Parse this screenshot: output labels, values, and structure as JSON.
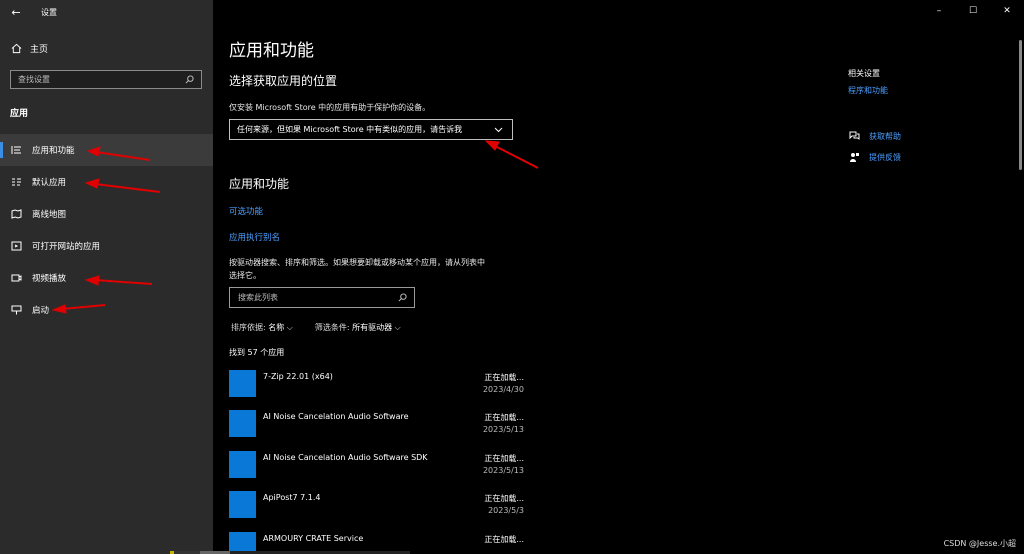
{
  "window": {
    "title": "设置",
    "controls": {
      "minimize": "–",
      "maximize": "☐",
      "close": "✕"
    }
  },
  "sidebar": {
    "home_label": "主页",
    "search_placeholder": "查找设置",
    "section_label": "应用",
    "items": [
      {
        "label": "应用和功能",
        "icon": "apps-list-icon",
        "active": true
      },
      {
        "label": "默认应用",
        "icon": "default-apps-icon",
        "active": false
      },
      {
        "label": "离线地图",
        "icon": "offline-maps-icon",
        "active": false
      },
      {
        "label": "可打开网站的应用",
        "icon": "apps-for-websites-icon",
        "active": false
      },
      {
        "label": "视频播放",
        "icon": "video-playback-icon",
        "active": false
      },
      {
        "label": "启动",
        "icon": "startup-icon",
        "active": false
      }
    ]
  },
  "main": {
    "page_title": "应用和功能",
    "source_section": {
      "heading": "选择获取应用的位置",
      "description": "仅安装 Microsoft Store 中的应用有助于保护你的设备。",
      "dropdown_value": "任何来源，但如果 Microsoft Store 中有类似的应用，请告诉我"
    },
    "apps_section": {
      "heading": "应用和功能",
      "link_optional_features": "可选功能",
      "link_app_aliases": "应用执行别名",
      "description_line1": "按驱动器搜索、排序和筛选。如果想要卸载或移动某个应用，请从列表中",
      "description_line2": "选择它。",
      "search_placeholder": "搜索此列表",
      "sort_label": "排序依据:",
      "sort_value": "名称",
      "filter_label": "筛选条件:",
      "filter_value": "所有驱动器",
      "found_count": "找到 57 个应用",
      "apps": [
        {
          "name": "7-Zip 22.01 (x64)",
          "status": "正在加载...",
          "date": "2023/4/30"
        },
        {
          "name": "AI Noise Cancelation Audio Software",
          "status": "正在加载...",
          "date": "2023/5/13"
        },
        {
          "name": "AI Noise Cancelation Audio Software SDK",
          "status": "正在加载...",
          "date": "2023/5/13"
        },
        {
          "name": "ApiPost7 7.1.4",
          "status": "正在加载...",
          "date": "2023/5/3"
        },
        {
          "name": "ARMOURY CRATE Service",
          "status": "正在加载...",
          "date": ""
        }
      ]
    }
  },
  "right_panel": {
    "related_title": "相关设置",
    "related_link": "程序和功能",
    "help_label": "获取帮助",
    "feedback_label": "提供反馈"
  },
  "watermark": "CSDN @Jesse.小超",
  "colors": {
    "accent_link": "#4a9fff",
    "app_icon": "#0a78d7",
    "sidebar_bg": "#2b2b2b",
    "annotation_arrow": "#e00000"
  }
}
